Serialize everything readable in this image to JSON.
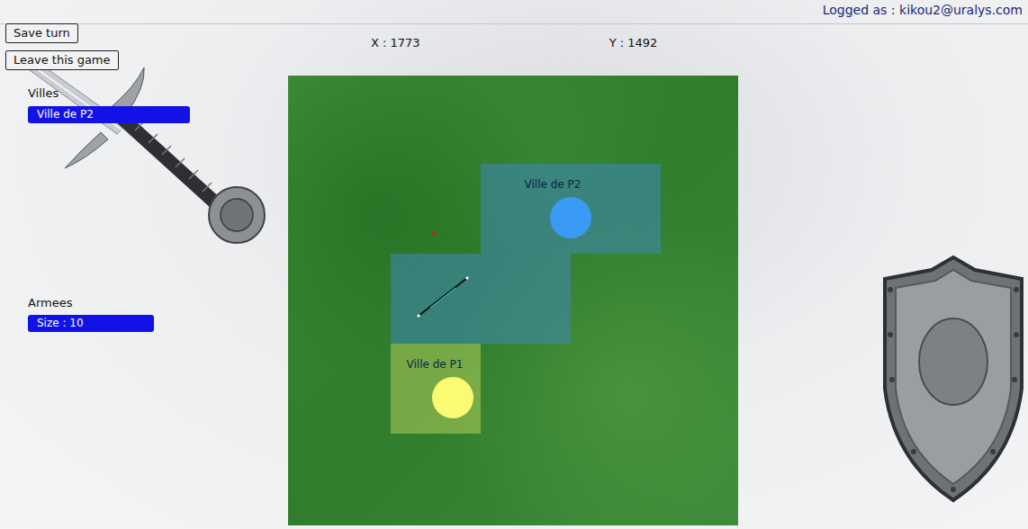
{
  "header": {
    "login": "Logged as : kikou2@uralys.com",
    "x": "X : 1773",
    "y": "Y : 1492"
  },
  "buttons": [
    "Save turn",
    "Leave this game"
  ],
  "cities": {
    "title": "Villes",
    "items": [
      {
        "label": "Ville de P2",
        "selected": true
      }
    ]
  },
  "armies": {
    "title": "Armees",
    "items": [
      {
        "label": "Size : 10",
        "selected": true
      }
    ]
  },
  "map": {
    "cities": [
      {
        "label": "Ville de P2",
        "color": "#3a9bf7"
      },
      {
        "label": "Ville de P1",
        "color": "#fbfb72"
      }
    ]
  }
}
